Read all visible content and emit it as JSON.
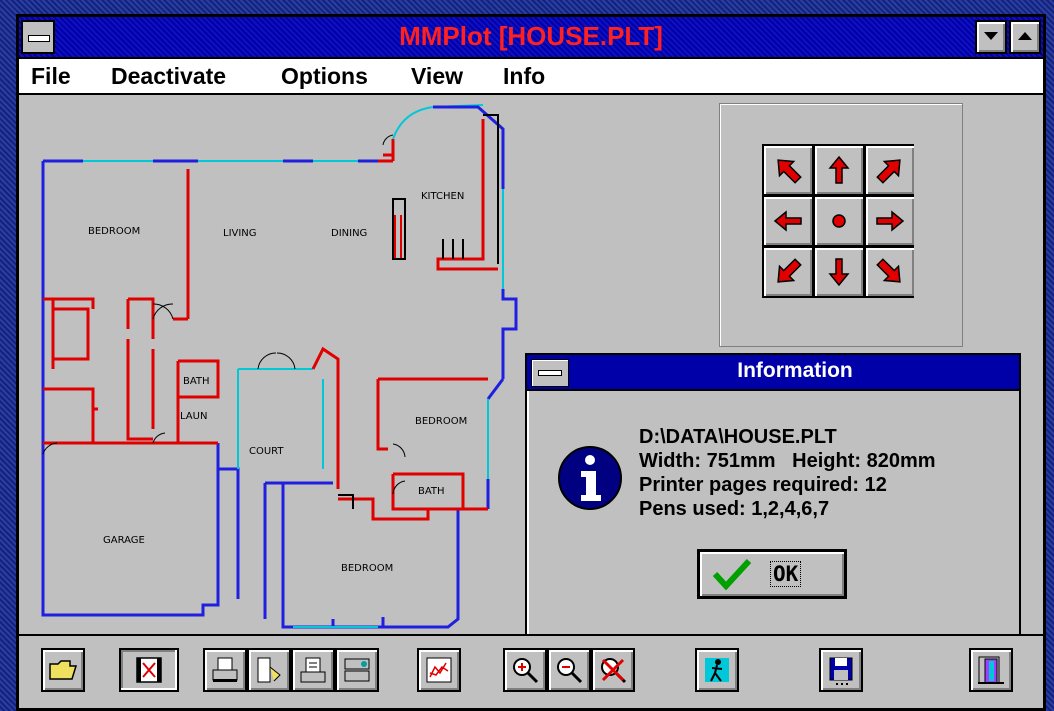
{
  "window": {
    "title": "MMPlot [HOUSE.PLT]"
  },
  "title_buttons": {
    "minimize_icon": "triangle-down",
    "maximize_icon": "triangle-up"
  },
  "menu": [
    {
      "label": "File"
    },
    {
      "label": "Deactivate"
    },
    {
      "label": "Options"
    },
    {
      "label": "View"
    },
    {
      "label": "Info"
    }
  ],
  "floorplan": {
    "labels": [
      "BEDROOM",
      "LIVING",
      "DINING",
      "KITCHEN",
      "BATH",
      "LAUN",
      "COURT",
      "BEDROOM",
      "BATH",
      "GARAGE",
      "BEDROOM"
    ]
  },
  "pan_pad": {
    "buttons": [
      "arrow-up-left",
      "arrow-up",
      "arrow-up-right",
      "arrow-left",
      "center-dot",
      "arrow-right",
      "arrow-down-left",
      "arrow-down",
      "arrow-down-right"
    ]
  },
  "dialog": {
    "title": "Information",
    "lines": [
      "D:\\DATA\\HOUSE.PLT",
      "Width: 751mm   Height: 820mm",
      "Printer pages required: 12",
      "Pens used: 1,2,4,6,7"
    ],
    "ok_label": "OK"
  },
  "toolbar": {
    "tools": [
      "open-folder",
      "film-frame",
      "printer",
      "plotter",
      "print-page",
      "printer-setup",
      "chart",
      "zoom-in",
      "zoom-out",
      "zoom-cancel",
      "run",
      "save-disk",
      "exit-door"
    ]
  },
  "colors": {
    "accent_blue": "#0000a8",
    "title_red": "#ff2020",
    "wall_blue": "#1f1fe0",
    "wall_red": "#e00000",
    "window_cyan": "#00c8d8"
  }
}
